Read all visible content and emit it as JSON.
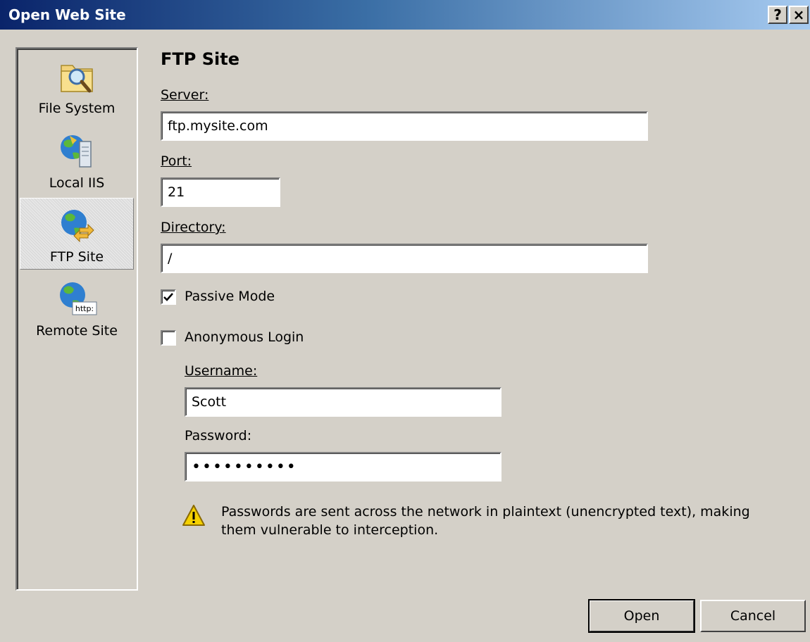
{
  "window": {
    "title": "Open Web Site",
    "help_label": "?",
    "close_label": "×"
  },
  "places": [
    {
      "label": "File System",
      "icon": "folder-search-icon"
    },
    {
      "label": "Local IIS",
      "icon": "iis-server-icon"
    },
    {
      "label": "FTP Site",
      "icon": "ftp-globe-icon",
      "selected": true
    },
    {
      "label": "Remote Site",
      "icon": "http-globe-icon"
    }
  ],
  "form": {
    "heading": "FTP Site",
    "server_label": "Server:",
    "server_value": "ftp.mysite.com",
    "port_label": "Port:",
    "port_value": "21",
    "directory_label": "Directory:",
    "directory_value": "/",
    "passive_label": "Passive Mode",
    "passive_checked": true,
    "anonymous_label": "Anonymous Login",
    "anonymous_checked": false,
    "username_label": "Username:",
    "username_value": "Scott",
    "password_label": "Password:",
    "password_value": "••••••••••",
    "warning_text": "Passwords are sent across the network in plaintext (unencrypted text), making them vulnerable to interception."
  },
  "buttons": {
    "open_label": "Open",
    "cancel_label": "Cancel"
  },
  "colors": {
    "title_bar_start": "#0a246a",
    "title_bar_end": "#a6caf0",
    "dialog_bg": "#d4d0c8",
    "warning_yellow": "#f5d100"
  }
}
